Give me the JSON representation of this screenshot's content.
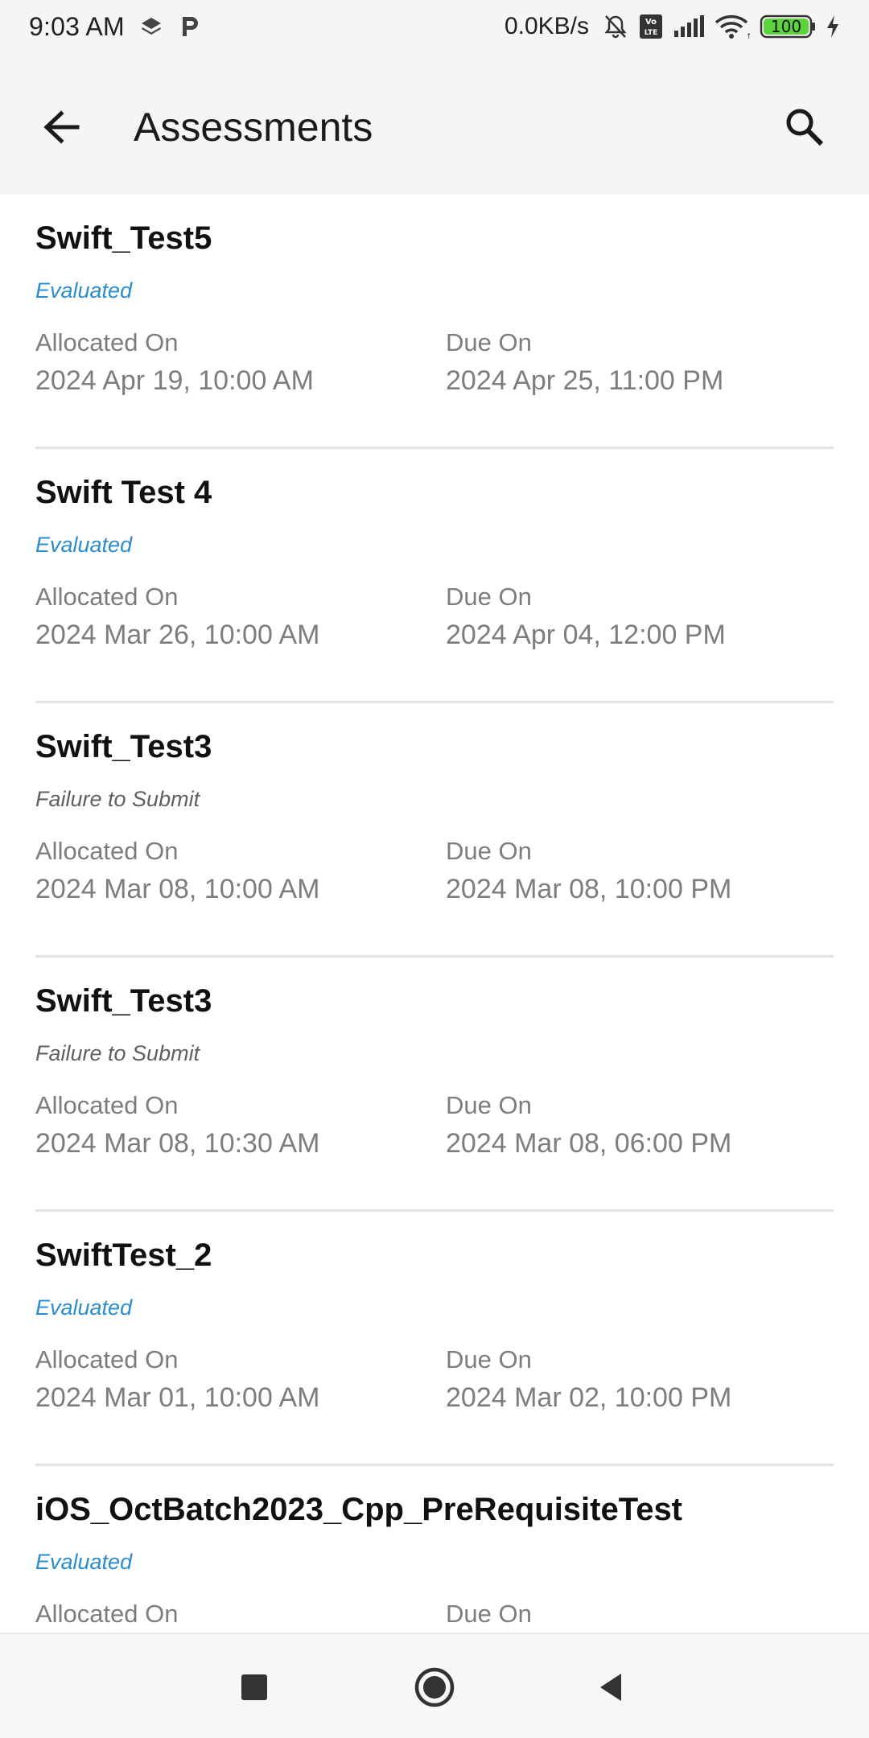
{
  "status_bar": {
    "time": "9:03 AM",
    "network_speed": "0.0KB/s",
    "battery": "100",
    "icons": [
      "layers-icon",
      "p-icon",
      "mute-icon",
      "volte-icon",
      "signal-icon",
      "wifi-icon",
      "battery-icon",
      "charging-icon"
    ]
  },
  "app_bar": {
    "title": "Assessments",
    "back_icon": "arrow-left-icon",
    "search_icon": "search-icon"
  },
  "labels": {
    "allocated": "Allocated On",
    "due": "Due On"
  },
  "colors": {
    "evaluated": "#2b8ccf",
    "failure": "#606060",
    "meta_text": "#7d7d7d",
    "appbar_bg": "#f7f5f4"
  },
  "assessments": [
    {
      "title": "Swift_Test5",
      "status": "Evaluated",
      "allocated_on": "2024 Apr 19, 10:00 AM",
      "due_on": "2024 Apr 25, 11:00 PM"
    },
    {
      "title": "Swift Test 4",
      "status": "Evaluated",
      "allocated_on": "2024 Mar 26, 10:00 AM",
      "due_on": "2024 Apr 04, 12:00 PM"
    },
    {
      "title": "Swift_Test3",
      "status": "Failure to Submit",
      "allocated_on": "2024 Mar 08, 10:00 AM",
      "due_on": "2024 Mar 08, 10:00 PM"
    },
    {
      "title": "Swift_Test3",
      "status": "Failure to Submit",
      "allocated_on": "2024 Mar 08, 10:30 AM",
      "due_on": "2024 Mar 08, 06:00 PM"
    },
    {
      "title": "SwiftTest_2",
      "status": "Evaluated",
      "allocated_on": "2024 Mar 01, 10:00 AM",
      "due_on": "2024 Mar 02, 10:00 PM"
    },
    {
      "title": "iOS_OctBatch2023_Cpp_PreRequisiteTest",
      "status": "Evaluated",
      "allocated_on": "",
      "due_on": ""
    }
  ],
  "nav_bar": {
    "icons": [
      "recents-icon",
      "home-icon",
      "back-triangle-icon"
    ]
  }
}
